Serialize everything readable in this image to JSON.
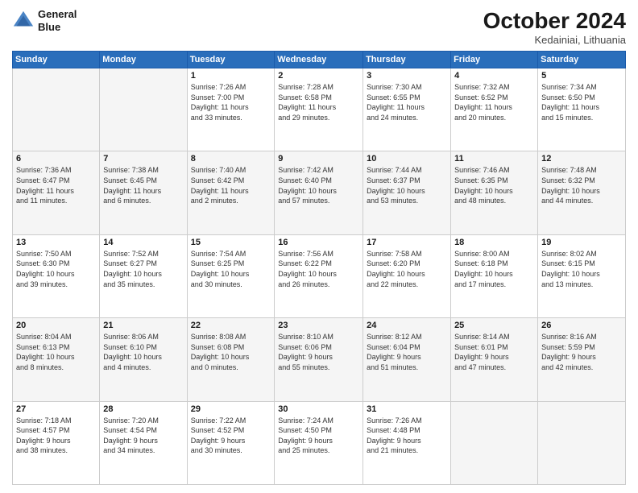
{
  "header": {
    "logo_line1": "General",
    "logo_line2": "Blue",
    "month": "October 2024",
    "location": "Kedainiai, Lithuania"
  },
  "weekdays": [
    "Sunday",
    "Monday",
    "Tuesday",
    "Wednesday",
    "Thursday",
    "Friday",
    "Saturday"
  ],
  "rows": [
    {
      "shaded": false,
      "cells": [
        {
          "day": "",
          "info": "",
          "empty": true
        },
        {
          "day": "",
          "info": "",
          "empty": true
        },
        {
          "day": "1",
          "info": "Sunrise: 7:26 AM\nSunset: 7:00 PM\nDaylight: 11 hours\nand 33 minutes."
        },
        {
          "day": "2",
          "info": "Sunrise: 7:28 AM\nSunset: 6:58 PM\nDaylight: 11 hours\nand 29 minutes."
        },
        {
          "day": "3",
          "info": "Sunrise: 7:30 AM\nSunset: 6:55 PM\nDaylight: 11 hours\nand 24 minutes."
        },
        {
          "day": "4",
          "info": "Sunrise: 7:32 AM\nSunset: 6:52 PM\nDaylight: 11 hours\nand 20 minutes."
        },
        {
          "day": "5",
          "info": "Sunrise: 7:34 AM\nSunset: 6:50 PM\nDaylight: 11 hours\nand 15 minutes."
        }
      ]
    },
    {
      "shaded": true,
      "cells": [
        {
          "day": "6",
          "info": "Sunrise: 7:36 AM\nSunset: 6:47 PM\nDaylight: 11 hours\nand 11 minutes."
        },
        {
          "day": "7",
          "info": "Sunrise: 7:38 AM\nSunset: 6:45 PM\nDaylight: 11 hours\nand 6 minutes."
        },
        {
          "day": "8",
          "info": "Sunrise: 7:40 AM\nSunset: 6:42 PM\nDaylight: 11 hours\nand 2 minutes."
        },
        {
          "day": "9",
          "info": "Sunrise: 7:42 AM\nSunset: 6:40 PM\nDaylight: 10 hours\nand 57 minutes."
        },
        {
          "day": "10",
          "info": "Sunrise: 7:44 AM\nSunset: 6:37 PM\nDaylight: 10 hours\nand 53 minutes."
        },
        {
          "day": "11",
          "info": "Sunrise: 7:46 AM\nSunset: 6:35 PM\nDaylight: 10 hours\nand 48 minutes."
        },
        {
          "day": "12",
          "info": "Sunrise: 7:48 AM\nSunset: 6:32 PM\nDaylight: 10 hours\nand 44 minutes."
        }
      ]
    },
    {
      "shaded": false,
      "cells": [
        {
          "day": "13",
          "info": "Sunrise: 7:50 AM\nSunset: 6:30 PM\nDaylight: 10 hours\nand 39 minutes."
        },
        {
          "day": "14",
          "info": "Sunrise: 7:52 AM\nSunset: 6:27 PM\nDaylight: 10 hours\nand 35 minutes."
        },
        {
          "day": "15",
          "info": "Sunrise: 7:54 AM\nSunset: 6:25 PM\nDaylight: 10 hours\nand 30 minutes."
        },
        {
          "day": "16",
          "info": "Sunrise: 7:56 AM\nSunset: 6:22 PM\nDaylight: 10 hours\nand 26 minutes."
        },
        {
          "day": "17",
          "info": "Sunrise: 7:58 AM\nSunset: 6:20 PM\nDaylight: 10 hours\nand 22 minutes."
        },
        {
          "day": "18",
          "info": "Sunrise: 8:00 AM\nSunset: 6:18 PM\nDaylight: 10 hours\nand 17 minutes."
        },
        {
          "day": "19",
          "info": "Sunrise: 8:02 AM\nSunset: 6:15 PM\nDaylight: 10 hours\nand 13 minutes."
        }
      ]
    },
    {
      "shaded": true,
      "cells": [
        {
          "day": "20",
          "info": "Sunrise: 8:04 AM\nSunset: 6:13 PM\nDaylight: 10 hours\nand 8 minutes."
        },
        {
          "day": "21",
          "info": "Sunrise: 8:06 AM\nSunset: 6:10 PM\nDaylight: 10 hours\nand 4 minutes."
        },
        {
          "day": "22",
          "info": "Sunrise: 8:08 AM\nSunset: 6:08 PM\nDaylight: 10 hours\nand 0 minutes."
        },
        {
          "day": "23",
          "info": "Sunrise: 8:10 AM\nSunset: 6:06 PM\nDaylight: 9 hours\nand 55 minutes."
        },
        {
          "day": "24",
          "info": "Sunrise: 8:12 AM\nSunset: 6:04 PM\nDaylight: 9 hours\nand 51 minutes."
        },
        {
          "day": "25",
          "info": "Sunrise: 8:14 AM\nSunset: 6:01 PM\nDaylight: 9 hours\nand 47 minutes."
        },
        {
          "day": "26",
          "info": "Sunrise: 8:16 AM\nSunset: 5:59 PM\nDaylight: 9 hours\nand 42 minutes."
        }
      ]
    },
    {
      "shaded": false,
      "cells": [
        {
          "day": "27",
          "info": "Sunrise: 7:18 AM\nSunset: 4:57 PM\nDaylight: 9 hours\nand 38 minutes."
        },
        {
          "day": "28",
          "info": "Sunrise: 7:20 AM\nSunset: 4:54 PM\nDaylight: 9 hours\nand 34 minutes."
        },
        {
          "day": "29",
          "info": "Sunrise: 7:22 AM\nSunset: 4:52 PM\nDaylight: 9 hours\nand 30 minutes."
        },
        {
          "day": "30",
          "info": "Sunrise: 7:24 AM\nSunset: 4:50 PM\nDaylight: 9 hours\nand 25 minutes."
        },
        {
          "day": "31",
          "info": "Sunrise: 7:26 AM\nSunset: 4:48 PM\nDaylight: 9 hours\nand 21 minutes."
        },
        {
          "day": "",
          "info": "",
          "empty": true
        },
        {
          "day": "",
          "info": "",
          "empty": true
        }
      ]
    }
  ]
}
